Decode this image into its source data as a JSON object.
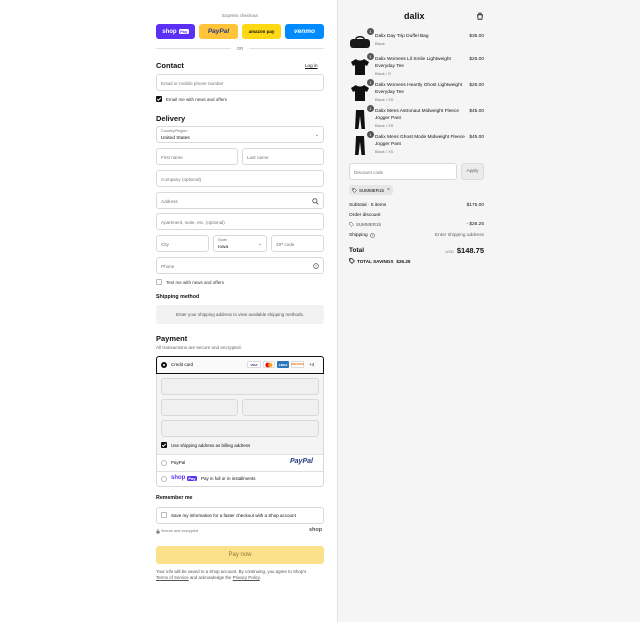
{
  "express": {
    "title": "Express checkout",
    "shop_pay": "shop",
    "shop_pay_badge": "Pay",
    "paypal": "PayPal",
    "amazon_pay": "amazon pay",
    "venmo": "venmo",
    "or": "OR"
  },
  "contact": {
    "heading": "Contact",
    "login": "Log in",
    "email_placeholder": "Email or mobile phone number",
    "news_label": "Email me with news and offers"
  },
  "delivery": {
    "heading": "Delivery",
    "country_label": "Country/Region",
    "country_value": "United States",
    "first_name": "First name",
    "last_name": "Last name",
    "company": "Company (optional)",
    "address": "Address",
    "apartment": "Apartment, suite, etc. (optional)",
    "city": "City",
    "state_label": "State",
    "state_value": "Iowa",
    "zip": "ZIP code",
    "phone": "Phone",
    "text_label": "Text me with news and offers"
  },
  "shipping": {
    "heading": "Shipping method",
    "notice": "Enter your shipping address to view available shipping methods."
  },
  "payment": {
    "heading": "Payment",
    "subtitle": "All transactions are secure and encrypted.",
    "credit_card": "Credit card",
    "more_cards": "+4",
    "cards": [
      "VISA",
      "MC",
      "AMEX",
      "DISCOVER"
    ],
    "billing_label": "Use shipping address as billing address",
    "paypal_label": "PayPal",
    "paypal_logo": "PayPal",
    "shop_pay_label": "Pay in full or in installments",
    "shop_pay_logo": "shop",
    "shop_pay_badge": "Pay"
  },
  "remember": {
    "heading": "Remember me",
    "save_label": "Save my information for a faster checkout with a Shop account",
    "secure": "Secure and encrypted",
    "shop_brand": "shop"
  },
  "pay_now": "Pay now",
  "legal": {
    "line1": "Your info will be saved to a Shop account. By continuing, you agree to Shop's",
    "terms": "Terms of Service",
    "and": "and acknowledge the",
    "privacy": "Privacy Policy",
    "period": "."
  },
  "summary": {
    "logo": "dalix",
    "items": [
      {
        "qty": "1",
        "title": "Dalix Day Trip Duffel Bag",
        "variant": "Black",
        "price": "$35.00"
      },
      {
        "qty": "1",
        "title": "Dalix Womens Lil Smile Lightweight Everyday Tee",
        "variant": "Black / S",
        "price": "$25.00"
      },
      {
        "qty": "1",
        "title": "Dalix Womens Heartly Ghost Lightweight Everyday Tee",
        "variant": "Black / XS",
        "price": "$25.00"
      },
      {
        "qty": "1",
        "title": "Dalix Mens Astronaut Midweight Fleece Jogger Pant",
        "variant": "Black / XS",
        "price": "$45.00"
      },
      {
        "qty": "1",
        "title": "Dalix Mens Ghost Mode Midweight Fleece Jogger Pant",
        "variant": "Black / XS",
        "price": "$45.00"
      }
    ],
    "discount_placeholder": "Discount code",
    "apply": "Apply",
    "code_tag": "SUMMER15",
    "subtotal_label": "Subtotal · 5 items",
    "subtotal_value": "$175.00",
    "order_discount_label": "Order discount",
    "order_discount_code": "SUMMER15",
    "order_discount_value": "- $26.25",
    "shipping_label": "Shipping",
    "shipping_value": "Enter shipping address",
    "total_label": "Total",
    "currency": "USD",
    "total_value": "$148.75",
    "savings_label": "TOTAL SAVINGS",
    "savings_value": "$26.25"
  }
}
